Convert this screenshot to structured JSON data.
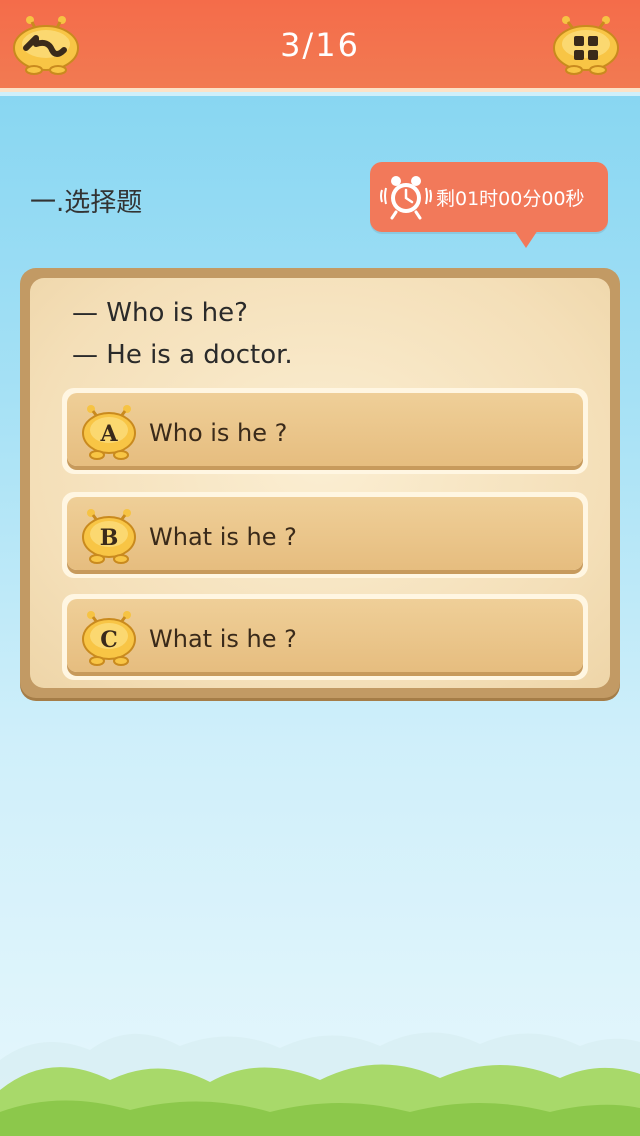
{
  "header": {
    "progress": "3/16",
    "back_icon": "back-arrow-icon",
    "menu_icon": "grid-menu-icon"
  },
  "section": {
    "title": "一.选择题"
  },
  "timer": {
    "text": "剩01时00分00秒",
    "icon": "alarm-clock-icon"
  },
  "question": {
    "line1": "— Who is he?",
    "line2": "— He is a doctor."
  },
  "options": [
    {
      "letter": "A",
      "text": "Who is he ?"
    },
    {
      "letter": "B",
      "text": "What is he ?"
    },
    {
      "letter": "C",
      "text": "What is he ?"
    }
  ],
  "colors": {
    "header": "#f46c4a",
    "timer": "#f2795a",
    "card_border": "#c29a64",
    "option_face": "#e6bd7f",
    "sky": "#7fd3f1"
  }
}
